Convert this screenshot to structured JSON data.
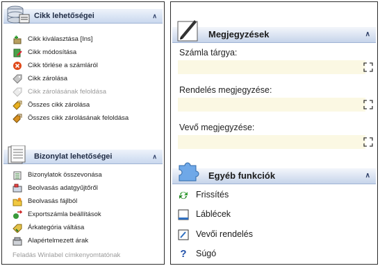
{
  "left": {
    "section1": {
      "title": "Cikk lehetőségei",
      "icon": "database-icon",
      "items": [
        {
          "label": "Cikk kiválasztása [Ins]",
          "icon": "add-item-icon",
          "enabled": true
        },
        {
          "label": "Cikk módosítása",
          "icon": "edit-item-icon",
          "enabled": true
        },
        {
          "label": "Cikk törlése a számláról",
          "icon": "delete-icon",
          "enabled": true
        },
        {
          "label": "Cikk zárolása",
          "icon": "lock-tag-icon",
          "enabled": true
        },
        {
          "label": "Cikk zárolásának feloldása",
          "icon": "unlock-tag-icon",
          "enabled": false
        },
        {
          "label": "Összes cikk zárolása",
          "icon": "lock-all-icon",
          "enabled": true
        },
        {
          "label": "Összes cikk zárolásának feloldása",
          "icon": "unlock-all-icon",
          "enabled": true
        }
      ]
    },
    "section2": {
      "title": "Bizonylat lehetőségei",
      "icon": "document-stack-icon",
      "items": [
        {
          "label": "Bizonylatok összevonása",
          "icon": "merge-icon",
          "enabled": true
        },
        {
          "label": "Beolvasás adatgyűjtőről",
          "icon": "scanner-icon",
          "enabled": true
        },
        {
          "label": "Beolvasás fájlból",
          "icon": "folder-icon",
          "enabled": true
        },
        {
          "label": "Exportszámla beállítások",
          "icon": "export-icon",
          "enabled": true
        },
        {
          "label": "Árkategória váltása",
          "icon": "price-icon",
          "enabled": true
        },
        {
          "label": "Alapértelmezett árak",
          "icon": "default-price-icon",
          "enabled": true
        },
        {
          "label": "Feladás Winlabel címkenyomtatónak",
          "icon": "label-printer-icon",
          "enabled": false
        }
      ]
    }
  },
  "right": {
    "notes": {
      "title": "Megjegyzések",
      "icon": "pen-icon",
      "fields": [
        {
          "label": "Számla tárgya:",
          "value": "",
          "button_icon": "expand-icon"
        },
        {
          "label": "Rendelés megjegyzése:",
          "value": "",
          "button_icon": "expand-icon"
        },
        {
          "label": "Vevő megjegyzése:",
          "value": "",
          "button_icon": "expand-icon"
        }
      ]
    },
    "other": {
      "title": "Egyéb funkciók",
      "icon": "puzzle-icon",
      "items": [
        {
          "label": "Frissítés",
          "icon": "refresh-icon"
        },
        {
          "label": "Láblécek",
          "icon": "footer-icon"
        },
        {
          "label": "Vevői rendelés",
          "icon": "customer-order-icon"
        },
        {
          "label": "Súgó",
          "icon": "help-icon"
        }
      ]
    }
  },
  "colors": {
    "header_gradient_top": "#eef3fb",
    "header_gradient_bottom": "#c9d8ee",
    "input_background": "#fbf8e3",
    "disabled_text": "#9a9a9a"
  }
}
